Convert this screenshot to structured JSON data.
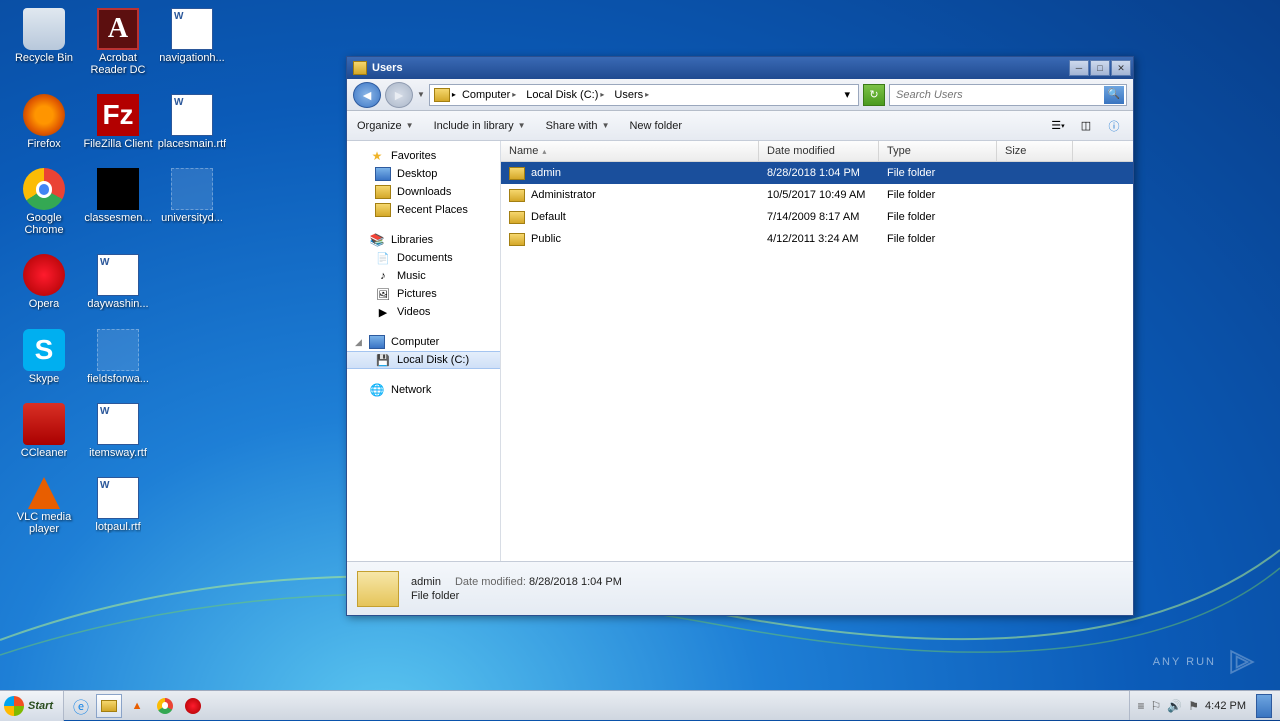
{
  "desktop": {
    "icons": [
      {
        "label": "Recycle Bin",
        "type": "recycle"
      },
      {
        "label": "Acrobat Reader DC",
        "type": "adobe"
      },
      {
        "label": "navigationh...",
        "type": "word"
      },
      {
        "label": "Firefox",
        "type": "firefox"
      },
      {
        "label": "FileZilla Client",
        "type": "filezilla"
      },
      {
        "label": "placesmain.rtf",
        "type": "word"
      },
      {
        "label": "Google Chrome",
        "type": "chrome"
      },
      {
        "label": "classesmen...",
        "type": "blank"
      },
      {
        "label": "universityd...",
        "type": "blank-light"
      },
      {
        "label": "Opera",
        "type": "opera"
      },
      {
        "label": "daywashin...",
        "type": "word"
      },
      {
        "label": "",
        "type": ""
      },
      {
        "label": "Skype",
        "type": "skype"
      },
      {
        "label": "fieldsforwa...",
        "type": "blank-light"
      },
      {
        "label": "",
        "type": ""
      },
      {
        "label": "CCleaner",
        "type": "ccleaner"
      },
      {
        "label": "itemsway.rtf",
        "type": "word"
      },
      {
        "label": "",
        "type": ""
      },
      {
        "label": "VLC media player",
        "type": "vlc"
      },
      {
        "label": "lotpaul.rtf",
        "type": "word"
      }
    ]
  },
  "window": {
    "title": "Users",
    "breadcrumbs": [
      "Computer",
      "Local Disk (C:)",
      "Users"
    ],
    "search_placeholder": "Search Users",
    "toolbar": {
      "organize": "Organize",
      "include": "Include in library",
      "share": "Share with",
      "newfolder": "New folder"
    },
    "columns": {
      "name": "Name",
      "date": "Date modified",
      "type": "Type",
      "size": "Size"
    },
    "col_widths": {
      "name": 258,
      "date": 120,
      "type": 118,
      "size": 76
    },
    "sidebar": {
      "favorites": {
        "label": "Favorites",
        "items": [
          "Desktop",
          "Downloads",
          "Recent Places"
        ]
      },
      "libraries": {
        "label": "Libraries",
        "items": [
          "Documents",
          "Music",
          "Pictures",
          "Videos"
        ]
      },
      "computer": {
        "label": "Computer",
        "items": [
          "Local Disk (C:)"
        ]
      },
      "network": {
        "label": "Network"
      }
    },
    "rows": [
      {
        "name": "admin",
        "date": "8/28/2018 1:04 PM",
        "type": "File folder",
        "size": "",
        "selected": true
      },
      {
        "name": "Administrator",
        "date": "10/5/2017 10:49 AM",
        "type": "File folder",
        "size": ""
      },
      {
        "name": "Default",
        "date": "7/14/2009 8:17 AM",
        "type": "File folder",
        "size": ""
      },
      {
        "name": "Public",
        "date": "4/12/2011 3:24 AM",
        "type": "File folder",
        "size": ""
      }
    ],
    "details": {
      "name": "admin",
      "date_label": "Date modified:",
      "date": "8/28/2018 1:04 PM",
      "type": "File folder"
    }
  },
  "taskbar": {
    "start": "Start",
    "clock": "4:42 PM"
  },
  "watermark": "ANY RUN"
}
